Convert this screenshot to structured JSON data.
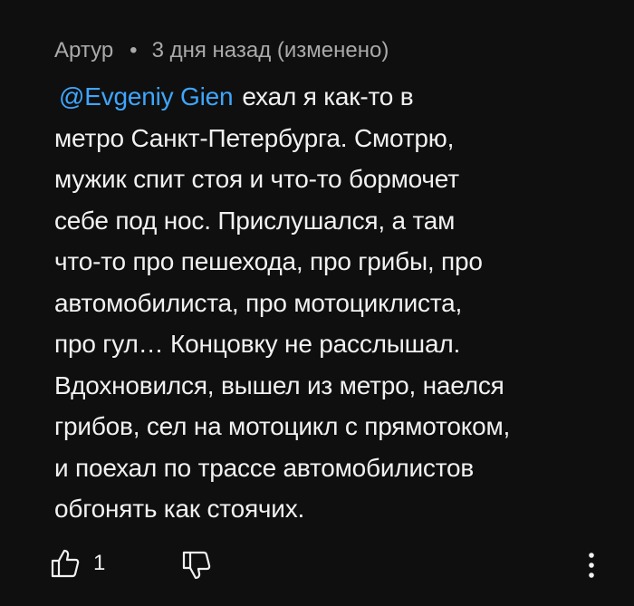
{
  "comment": {
    "author": "Артур",
    "separator": "•",
    "timestamp": "3 дня назад (изменено)",
    "mention": "@Evgeniy Gien",
    "text_first": "ехал я как-то в",
    "text_rest": "метро Санкт-Петербурга. Смотрю,\nмужик спит стоя и что-то бормочет\nсебе под нос. Прислушался, а там\nчто-то про пешехода, про грибы, про\nавтомобилиста, про мотоциклиста,\nпро гул… Концовку не расслышал.\nВдохновился, вышел из метро, наелся\nгрибов, сел на мотоцикл с прямотоком,\nи поехал по трассе  автомобилистов\nобгонять как стоячих."
  },
  "actions": {
    "like_icon": "thumbs-up-icon",
    "like_count": "1",
    "dislike_icon": "thumbs-down-icon",
    "more_icon": "more-vertical-icon"
  },
  "colors": {
    "background": "#0f0f0f",
    "text": "#f1f1f1",
    "muted": "#aaaaaa",
    "link": "#3ea6ff"
  }
}
